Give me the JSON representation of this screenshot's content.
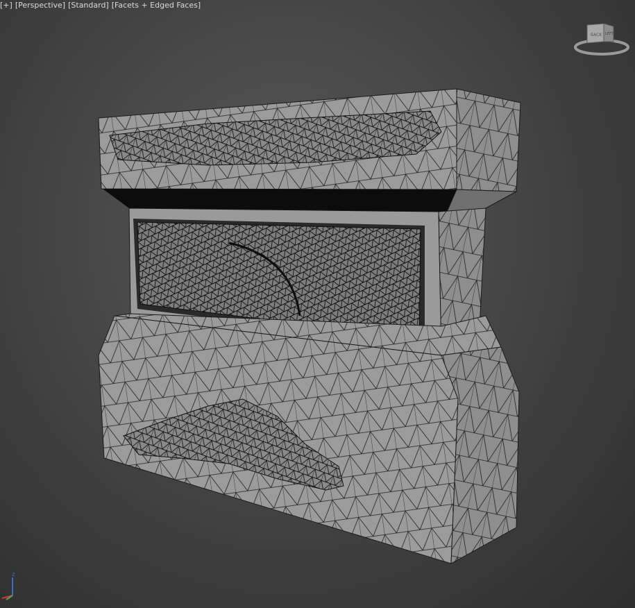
{
  "viewport": {
    "labels": {
      "view_menu": "[+]",
      "view_type": "[Perspective]",
      "shading_style": "[Standard]",
      "display_mode": "[Facets + Edged Faces]"
    },
    "viewcube": {
      "front_text": "BACK",
      "right_text": "LEFT"
    },
    "axis": {
      "z_label": "z"
    }
  },
  "colors": {
    "viewport_background": "#474747",
    "mesh_face": "#9b9b9b",
    "mesh_edge": "#1a1a1a",
    "viewport_label_text": "#dcdcdc",
    "axis_z": "#3a6bc8",
    "axis_x": "#d03a2a",
    "axis_y": "#3eb34a"
  }
}
